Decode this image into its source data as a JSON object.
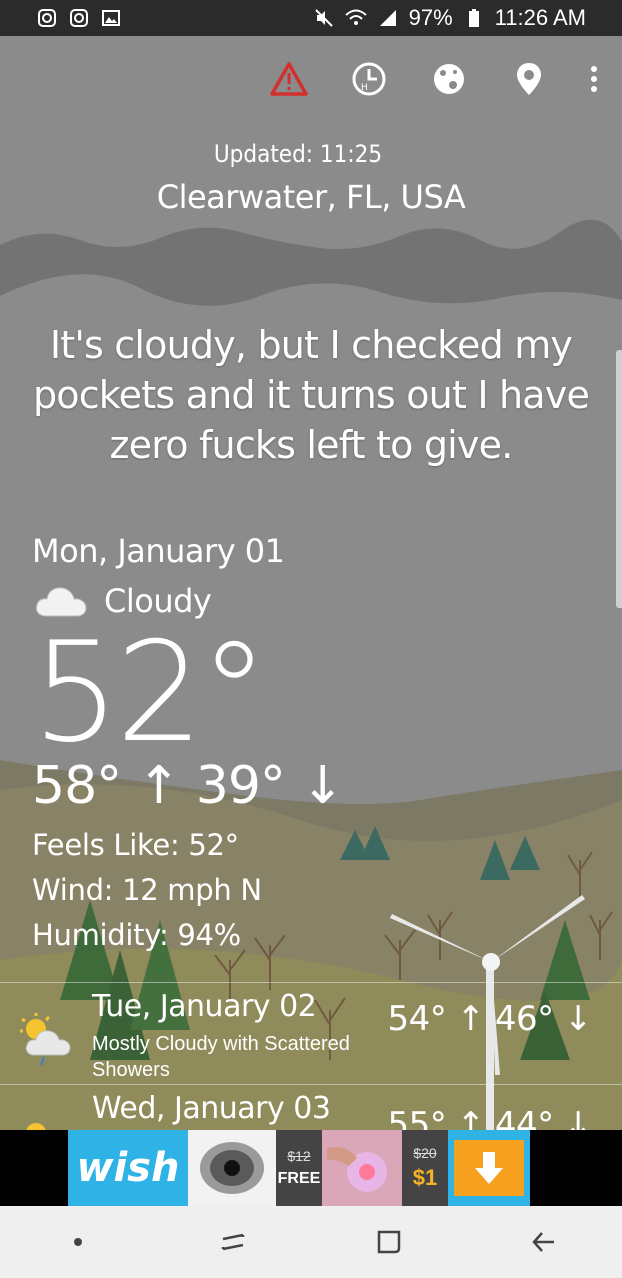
{
  "status_bar": {
    "battery": "97%",
    "time": "11:26 AM"
  },
  "toolbar": {
    "icons": [
      "alert-icon",
      "history-icon",
      "moon-phase-icon",
      "location-pin-icon",
      "more-vert-icon"
    ],
    "accent_alert": "#d32f2f"
  },
  "header": {
    "updated": "Updated: 11:25",
    "location": "Clearwater, FL, USA"
  },
  "quote": "It's cloudy, but I checked my pockets and it turns out I have zero fucks left to give.",
  "today": {
    "date": "Mon, January 01",
    "condition": "Cloudy",
    "temp": "52°",
    "high": "58°",
    "low": "39°",
    "feels_like": "Feels Like: 52°",
    "wind": "Wind: 12 mph N",
    "humidity": "Humidity: 94%"
  },
  "forecast": [
    {
      "day": "Tue, January 02",
      "desc": "Mostly Cloudy with Scattered Showers",
      "high": "54°",
      "low": "46°"
    },
    {
      "day": "Wed, January 03",
      "desc": "",
      "high": "55°",
      "low": "44°"
    }
  ],
  "ad": {
    "brand": "wish",
    "price1_old": "$12",
    "price1_new": "FREE",
    "price2_old": "$20",
    "price2_new": "$1"
  },
  "colors": {
    "status_bar": "#2b2b2b",
    "sky": "#8a8a8a",
    "nav_bar": "#efefef",
    "ad_blue": "#2fb3e6",
    "ad_orange": "#f6a020"
  }
}
